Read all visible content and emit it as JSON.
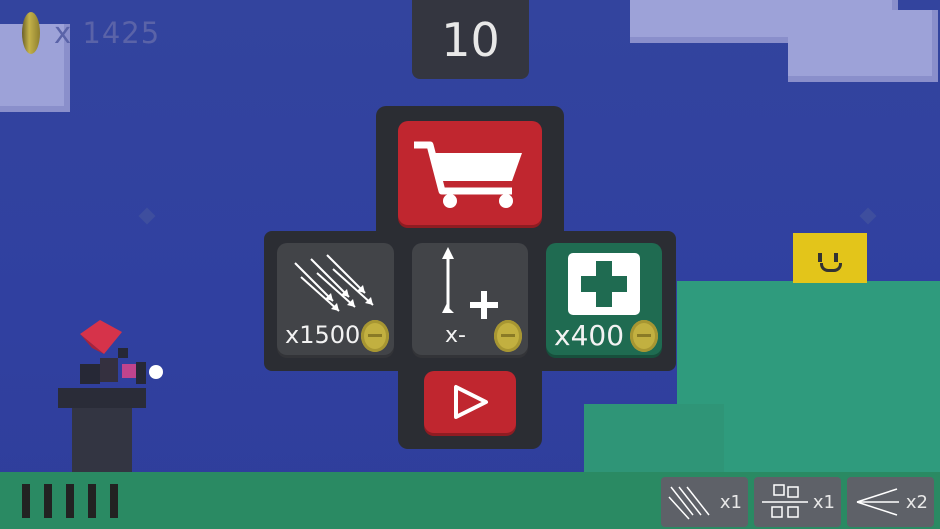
{
  "hud": {
    "coin_icon": "coin-icon",
    "coin_count": "x 1425",
    "score": "10",
    "lives_shown": 5
  },
  "menu": {
    "shop_icon": "shopping-cart-icon",
    "play_icon": "play-icon",
    "items": [
      {
        "name": "multi-arrow",
        "icon": "multi-arrows-icon",
        "price": "x1500"
      },
      {
        "name": "arrow-speed",
        "icon": "arrow-plus-icon",
        "price": "x-"
      },
      {
        "name": "health",
        "icon": "medkit-icon",
        "price": "x400"
      }
    ]
  },
  "powerups": [
    {
      "icon": "multi-arrows-icon",
      "count": "x1"
    },
    {
      "icon": "split-target-icon",
      "count": "x1"
    },
    {
      "icon": "spread-arrow-icon",
      "count": "x2"
    }
  ],
  "colors": {
    "sky": "#3040a0",
    "panel": "#2b2d33",
    "tile": "#424448",
    "shop_red": "#c0262f",
    "health_green": "#1f6b51",
    "coin": "#c2b040",
    "hill": "#2f9b7d",
    "enemy_yellow": "#e3c51a"
  }
}
